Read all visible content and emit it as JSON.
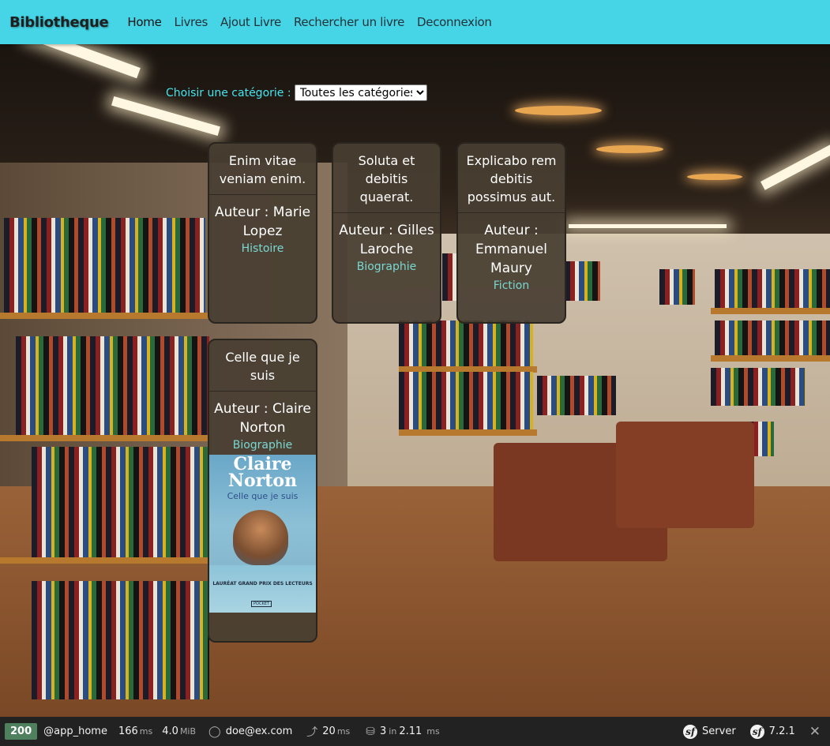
{
  "navbar": {
    "brand": "Bibliotheque",
    "links": [
      "Home",
      "Livres",
      "Ajout Livre",
      "Rechercher un livre",
      "Deconnexion"
    ]
  },
  "filter": {
    "label": "Choisir une catégorie :",
    "selected": "Toutes les catégories"
  },
  "books": [
    {
      "title": "Enim vitae veniam enim.",
      "author": "Auteur : Marie Lopez",
      "category": "Histoire"
    },
    {
      "title": "Soluta et debitis quaerat.",
      "author": "Auteur : Gilles Laroche",
      "category": "Biographie"
    },
    {
      "title": "Explicabo rem debitis possimus aut.",
      "author": "Auteur : Emmanuel Maury",
      "category": "Fiction"
    },
    {
      "title": "Celle que je suis",
      "author": "Auteur : Claire Norton",
      "category": "Biographie",
      "cover": {
        "author": "Claire Norton",
        "title": "Celle que je suis",
        "award": "LAURÉAT GRAND PRIX DES LECTEURS",
        "publisher": "POCKET"
      }
    }
  ],
  "toolbar": {
    "status": "200",
    "route": "@app_home",
    "time": "166",
    "time_unit": "ms",
    "memory": "4.0",
    "memory_unit": "MiB",
    "user": "doe@ex.com",
    "events": "20",
    "events_unit": "ms",
    "db_queries": "3",
    "db_in": "in",
    "db_time": "2.11",
    "db_unit": "ms",
    "server": "Server",
    "version": "7.2.1"
  },
  "colors": {
    "navbar": "#45d5e6",
    "filter_label": "#45e5f0",
    "card_bg": "#483e32",
    "category": "#78d8d2",
    "toolbar_bg": "#222222",
    "status_badge": "#4f805d"
  }
}
